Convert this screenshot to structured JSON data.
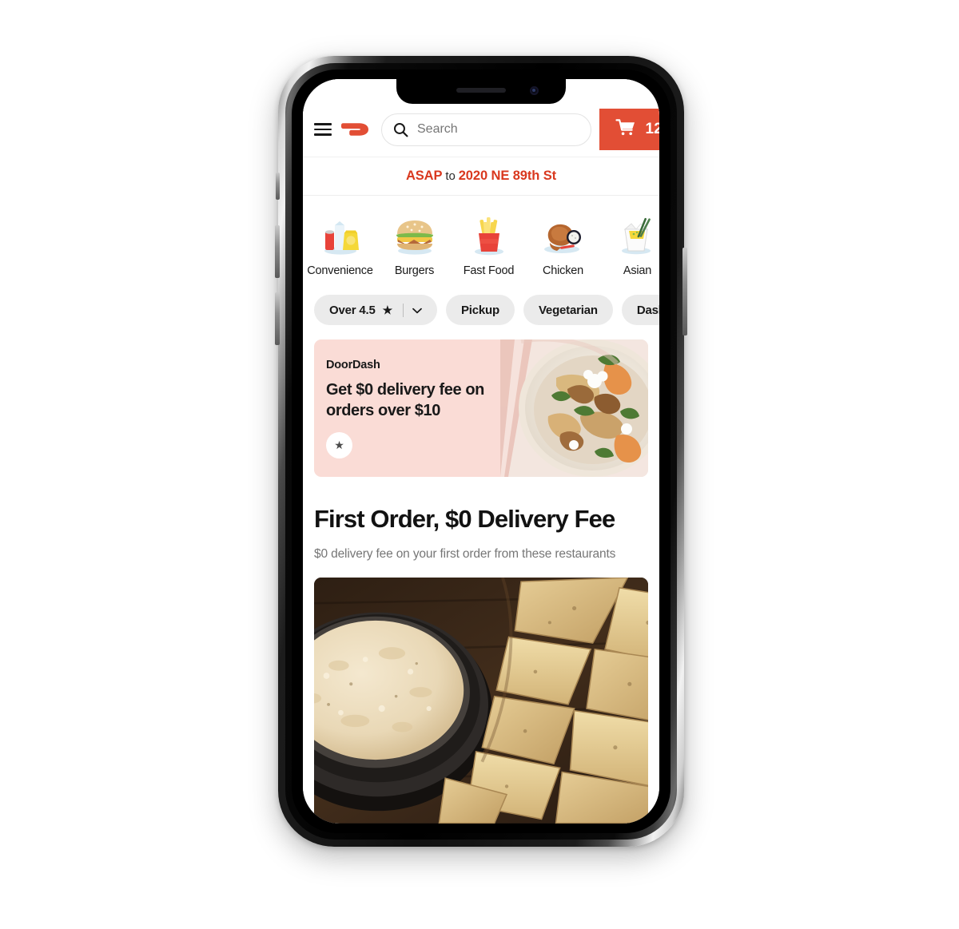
{
  "app": {
    "brand": "DoorDash",
    "accent_color": "#e24e35",
    "promo_bg_color": "#fadcd6"
  },
  "header": {
    "menu_icon": "hamburger-menu-icon",
    "logo_icon": "doordash-logo-icon",
    "search": {
      "icon": "search-icon",
      "placeholder": "Search",
      "value": ""
    },
    "cart": {
      "icon": "shopping-cart-icon",
      "count": "12"
    }
  },
  "address_bar": {
    "time": "ASAP",
    "connector": "to",
    "destination": "2020 NE 89th St"
  },
  "categories": [
    {
      "label": "Convenience",
      "icon": "convenience-store-icon"
    },
    {
      "label": "Burgers",
      "icon": "burger-icon"
    },
    {
      "label": "Fast Food",
      "icon": "french-fries-icon"
    },
    {
      "label": "Chicken",
      "icon": "roast-chicken-icon"
    },
    {
      "label": "Asian",
      "icon": "takeout-box-icon"
    }
  ],
  "filters": [
    {
      "label": "Over 4.5",
      "star": "★",
      "has_dropdown": true,
      "chevron": "⌄"
    },
    {
      "label": "Pickup",
      "has_dropdown": false
    },
    {
      "label": "Vegetarian",
      "has_dropdown": false
    },
    {
      "label": "DashPa",
      "has_dropdown": false
    }
  ],
  "promo": {
    "brand": "DoorDash",
    "title": "Get $0 delivery fee on orders over $10",
    "badge_icon": "star-icon",
    "badge_glyph": "★",
    "image": "chicken-salad-bowl-photo"
  },
  "section": {
    "title": "First Order, $0 Delivery Fee",
    "subtitle": "$0 delivery fee on your first order from these restaurants"
  },
  "featured_card": {
    "image": "queso-dip-with-tortilla-chips-photo"
  }
}
